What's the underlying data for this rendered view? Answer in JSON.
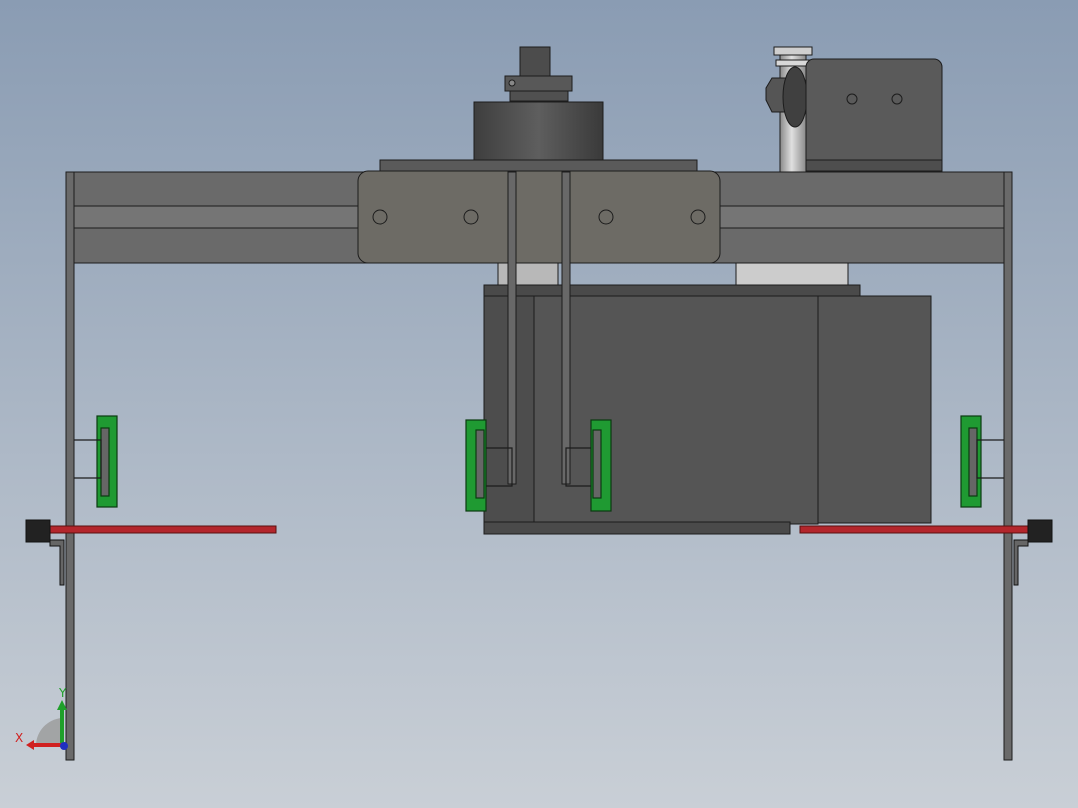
{
  "viewport": {
    "background_top": "#8a9cb3",
    "background_bottom": "#c9cfd6"
  },
  "colors": {
    "frame": "#6b6b6b",
    "frame_dark": "#4a4a4a",
    "body_dark": "#545454",
    "body_darker": "#3f3f3f",
    "plate": "#6e6c66",
    "green_guide": "#1f9a32",
    "red_rod": "#b3262c",
    "light_metal": "#b7b7b7",
    "outline": "#1c1c1c"
  },
  "triad": {
    "x_label": "X",
    "y_label": "Y",
    "x_color": "#d02020",
    "y_color": "#1fa02a",
    "z_color": "#2030c0"
  }
}
